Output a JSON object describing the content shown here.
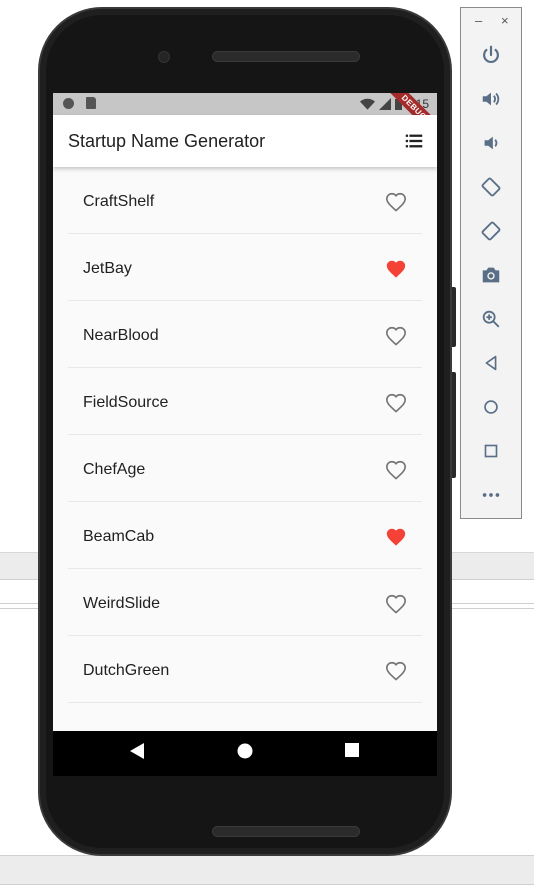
{
  "app": {
    "title": "Startup Name Generator",
    "debug_banner": "DEBUG"
  },
  "status_bar": {
    "time": "7:15"
  },
  "list": {
    "items": [
      {
        "name": "CraftShelf",
        "saved": false
      },
      {
        "name": "JetBay",
        "saved": true
      },
      {
        "name": "NearBlood",
        "saved": false
      },
      {
        "name": "FieldSource",
        "saved": false
      },
      {
        "name": "ChefAge",
        "saved": false
      },
      {
        "name": "BeamCab",
        "saved": true
      },
      {
        "name": "WeirdSlide",
        "saved": false
      },
      {
        "name": "DutchGreen",
        "saved": false
      }
    ]
  },
  "emulator_toolbar": {
    "minimize_label": "–",
    "close_label": "×",
    "buttons": [
      "power-icon",
      "volume-up-icon",
      "volume-down-icon",
      "rotate-left-icon",
      "rotate-right-icon",
      "camera-icon",
      "zoom-icon",
      "back-icon",
      "home-icon",
      "overview-icon",
      "more-icon"
    ]
  },
  "colors": {
    "heart_saved": "#f44336",
    "heart_unsaved": "#757575",
    "app_bar": "#ffffff",
    "status_bar": "#c6c6c6"
  }
}
